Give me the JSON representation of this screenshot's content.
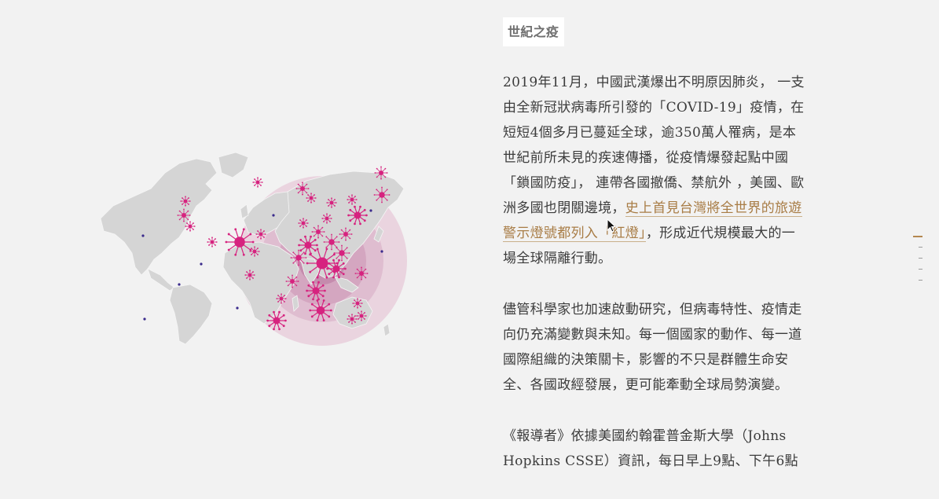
{
  "section": {
    "title": "世紀之疫"
  },
  "article": {
    "p1_before_link": "2019年11月，中國武漢爆出不明原因肺炎， 一支由全新冠狀病毒所引發的「COVID-19」疫情，在短短4個多月已蔓延全球，逾350萬人罹病，是本世紀前所未見的疾速傳播，從疫情爆發起點中國「鎖國防疫」， 連帶各國撤僑、禁航外 ，美國、歐洲多國也閉關邊境，",
    "p1_link": "史上首見台灣將全世界的旅遊警示燈號都列入「紅燈」",
    "p1_after_link": "，形成近代規模最大的一場全球隔離行動。",
    "p2": "儘管科學家也加速啟動研究，但病毒特性、疫情走向仍充滿變數與未知。每一個國家的動作、每一道國際組織的決策關卡，影響的不只是群體生命安全、各國政經發展，更可能牽動全球局勢演變。",
    "p3": "《報導者》依據美國約翰霍普金斯大學（Johns Hopkins CSSE）資訊，每日早上9點、下午6點"
  },
  "colors": {
    "background": "#f2f2f2",
    "land": "#d4d4d4",
    "virus": "#d6237f",
    "virus_small": "#3a2a8c",
    "halo": "#c98fb0",
    "link": "#a87c45",
    "nav_active": "#b4874f"
  },
  "map": {
    "icon": "virus-icon"
  },
  "nav": {
    "count": 5,
    "active_index": 0
  }
}
